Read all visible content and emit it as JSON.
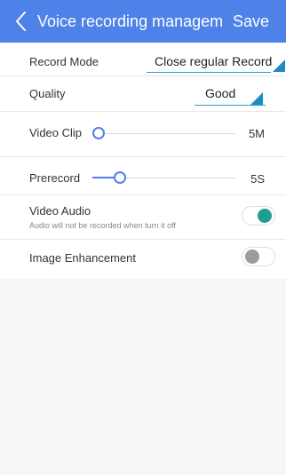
{
  "header": {
    "title": "Voice recording management",
    "save_label": "Save"
  },
  "settings": {
    "record_mode": {
      "label": "Record Mode",
      "value": "Close regular Record"
    },
    "quality": {
      "label": "Quality",
      "value": "Good"
    },
    "video_clip": {
      "label": "Video Clip",
      "value": "5M",
      "slider_level": 0
    },
    "prerecord": {
      "label": "Prerecord",
      "value": "5S",
      "slider_level": 0.18
    },
    "video_audio": {
      "label": "Video Audio",
      "sublabel": "Audio will not be recorded when turn it off",
      "enabled": true
    },
    "image_enhancement": {
      "label": "Image Enhancement",
      "enabled": false
    }
  },
  "colors": {
    "header": "#4e82e8",
    "accent": "#1e9f92",
    "select_triangle": "#1c8cc7"
  },
  "icons": {
    "back": "chevron-left-icon",
    "toggle_on": "toggle-on-icon",
    "toggle_off": "toggle-off-icon"
  }
}
